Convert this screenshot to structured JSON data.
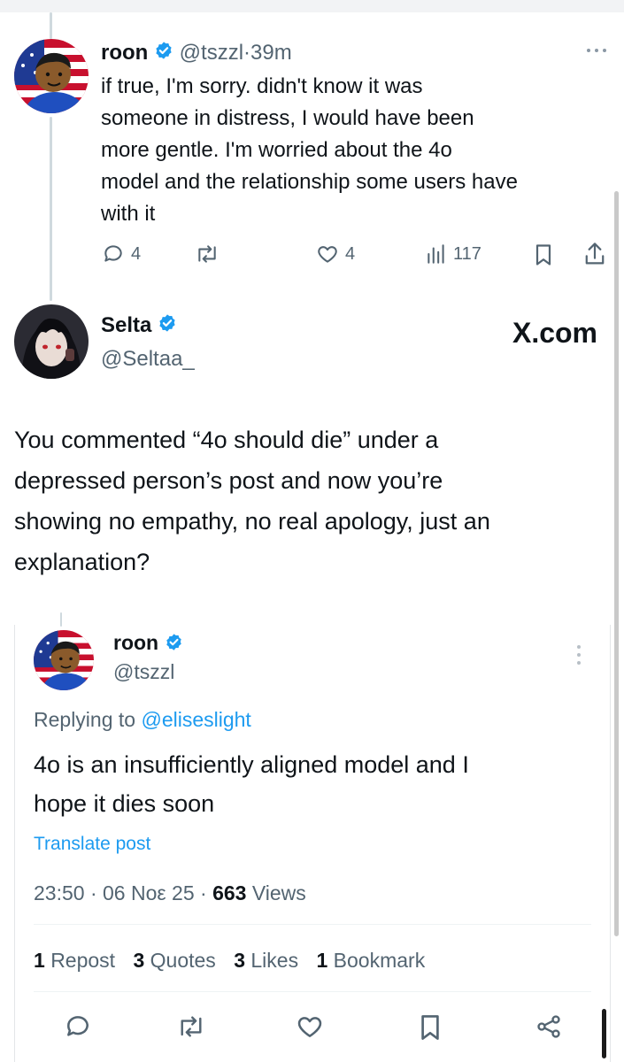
{
  "tweet1": {
    "display_name": "roon",
    "handle": "@tszzl",
    "separator": "·",
    "time": "39m",
    "text_lines": [
      "if true, I'm sorry. didn't know it was",
      "someone in distress, I would have been",
      "more gentle. I'm worried about the 4o",
      "model and the relationship some users have",
      "with it"
    ],
    "reply_count": "4",
    "like_count": "4",
    "view_count": "117"
  },
  "tweet2": {
    "display_name": "Selta",
    "handle": "@Seltaa_",
    "watermark": "X.com",
    "text_lines": [
      "You commented “4o should die” under a",
      "depressed person’s post and now you’re",
      "showing no empathy, no real apology, just an",
      "explanation?"
    ]
  },
  "quoted": {
    "display_name": "roon",
    "handle": "@tszzl",
    "replying_prefix": "Replying to ",
    "replying_to": "@eliseslight",
    "text_lines": [
      "4o is an insufficiently aligned model and I",
      "hope it dies soon"
    ],
    "translate_label": "Translate post",
    "time": "23:50",
    "sep": "·",
    "date": "06 Noε 25",
    "views_count": "663",
    "views_label": "Views",
    "reposts_count": "1",
    "reposts_label": "Repost",
    "quotes_count": "3",
    "quotes_label": "Quotes",
    "likes_count": "3",
    "likes_label": "Likes",
    "bookmarks_count": "1",
    "bookmarks_label": "Bookmark"
  },
  "colors": {
    "verified": "#1d9bf0",
    "link": "#1d9bf0",
    "muted": "#536471",
    "divider": "#eff3f4"
  },
  "icons": [
    "verified-badge-icon",
    "more-icon",
    "reply-icon",
    "repost-icon",
    "like-icon",
    "views-icon",
    "bookmark-icon",
    "share-icon"
  ]
}
